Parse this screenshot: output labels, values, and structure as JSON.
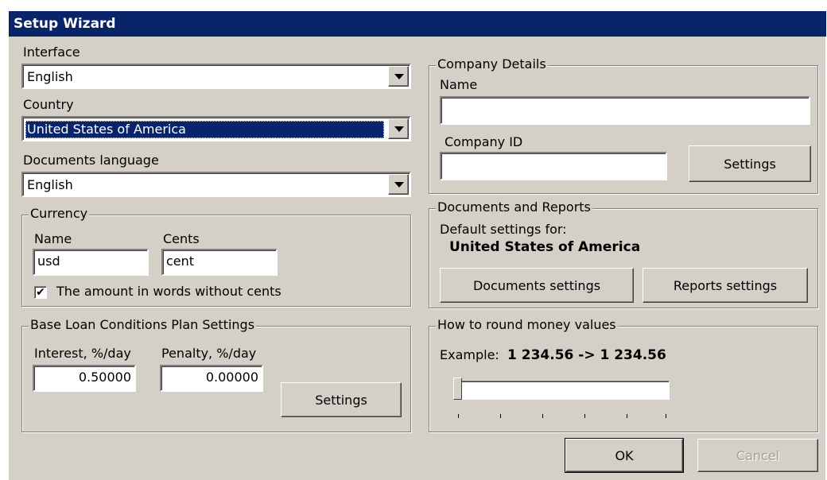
{
  "window": {
    "title": "Setup Wizard"
  },
  "interface": {
    "label": "Interface",
    "value": "English"
  },
  "country": {
    "label": "Country",
    "value": "United States of America"
  },
  "documents_language": {
    "label": "Documents language",
    "value": "English"
  },
  "currency": {
    "legend": "Currency",
    "name_label": "Name",
    "name_value": "usd",
    "cents_label": "Cents",
    "cents_value": "cent",
    "checkbox_label": "The amount in words without cents",
    "checkbox_checked": true,
    "check_mark": "✔"
  },
  "loan": {
    "legend": "Base Loan Conditions Plan Settings",
    "interest_label": "Interest, %/day",
    "interest_value": "0.50000",
    "penalty_label": "Penalty, %/day",
    "penalty_value": "0.00000",
    "settings_button": "Settings"
  },
  "company": {
    "legend": "Company Details",
    "name_label": "Name",
    "name_value": "",
    "id_label": "Company ID",
    "id_value": "",
    "settings_button": "Settings"
  },
  "docs_reports": {
    "legend": "Documents and Reports",
    "default_for_label": "Default settings for:",
    "country_name": "United States of America",
    "documents_button": "Documents settings",
    "reports_button": "Reports settings"
  },
  "rounding": {
    "legend": "How to round money values",
    "example_label": "Example:",
    "example_value": "1 234.56 -> 1 234.56",
    "slider_position": 0,
    "slider_ticks": 6
  },
  "footer": {
    "ok_button": "OK",
    "cancel_button": "Cancel",
    "cancel_disabled": true
  },
  "colors": {
    "titlebar": "#0a246a",
    "face": "#d4d0c8",
    "selection": "#0a246a"
  }
}
